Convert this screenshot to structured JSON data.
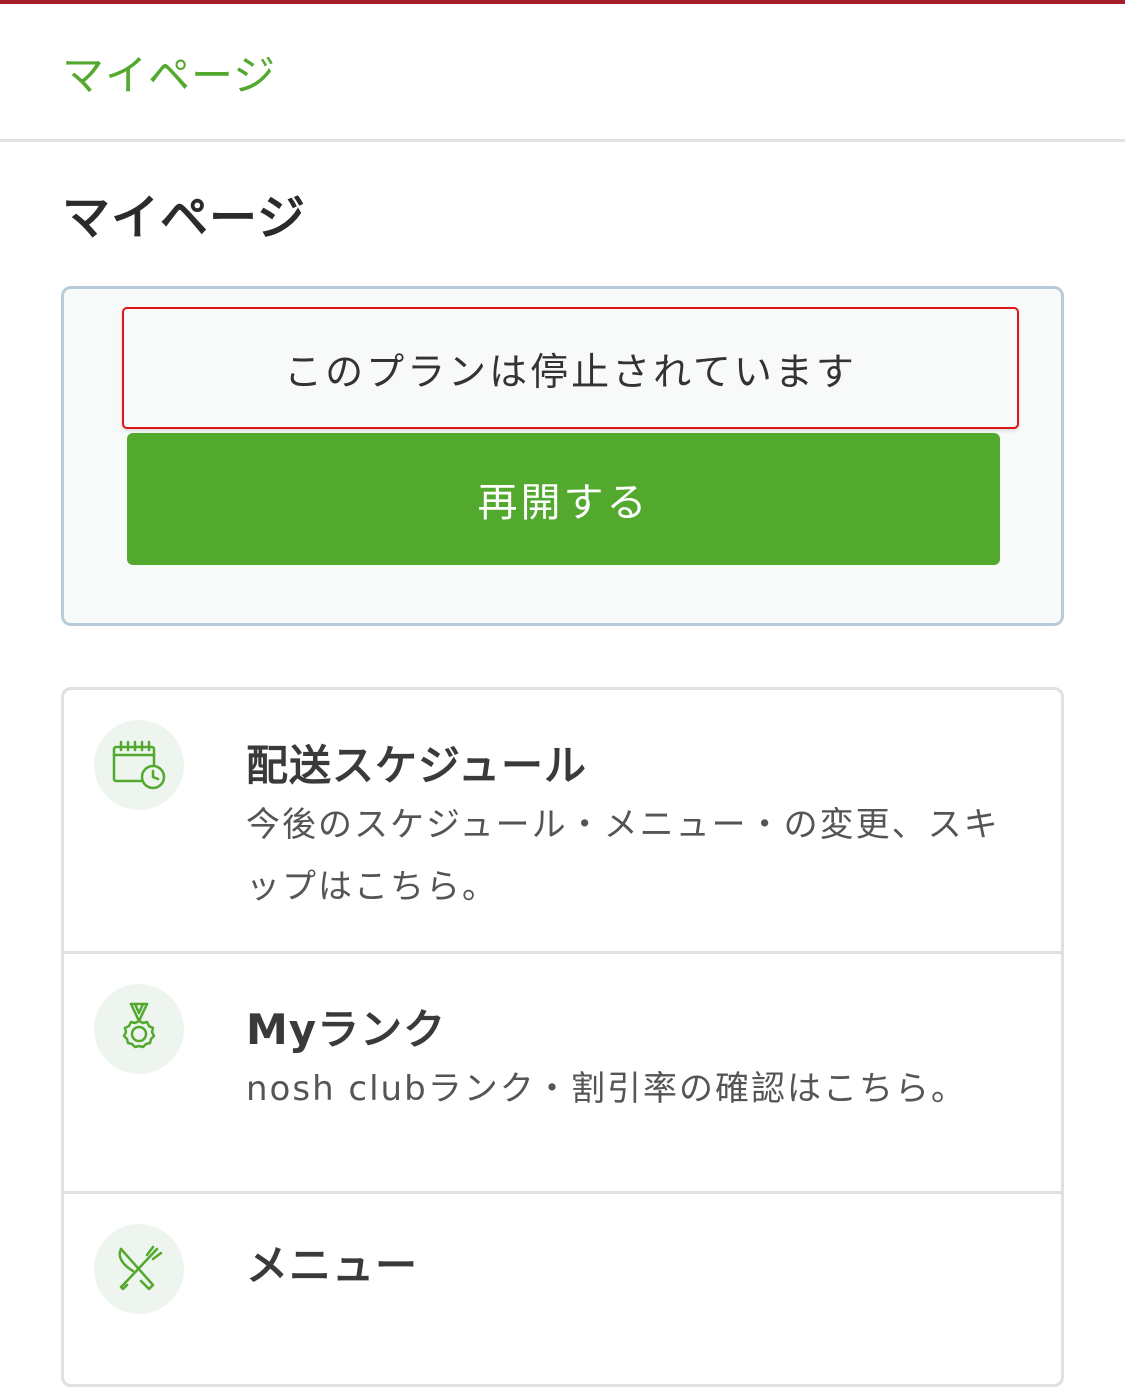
{
  "colors": {
    "accent": "#53a82e",
    "top_strip": "#a61d2a",
    "status_border": "#e1131d",
    "icon_bg": "#edf5ee"
  },
  "breadcrumb": {
    "label": "マイページ"
  },
  "page": {
    "title": "マイページ"
  },
  "plan": {
    "status_text": "このプランは停止されています",
    "resume_label": "再開する"
  },
  "menu": {
    "items": [
      {
        "icon": "calendar-clock-icon",
        "title": "配送スケジュール",
        "description_line1": "今後のスケジュール・メニュー・の変更、スキ",
        "description_line2": "ップはこちら。"
      },
      {
        "icon": "medal-icon",
        "title": "Myランク",
        "description_line1": "nosh clubランク・割引率の確認はこちら。"
      },
      {
        "icon": "fork-knife-icon",
        "title": "メニュー"
      }
    ]
  }
}
